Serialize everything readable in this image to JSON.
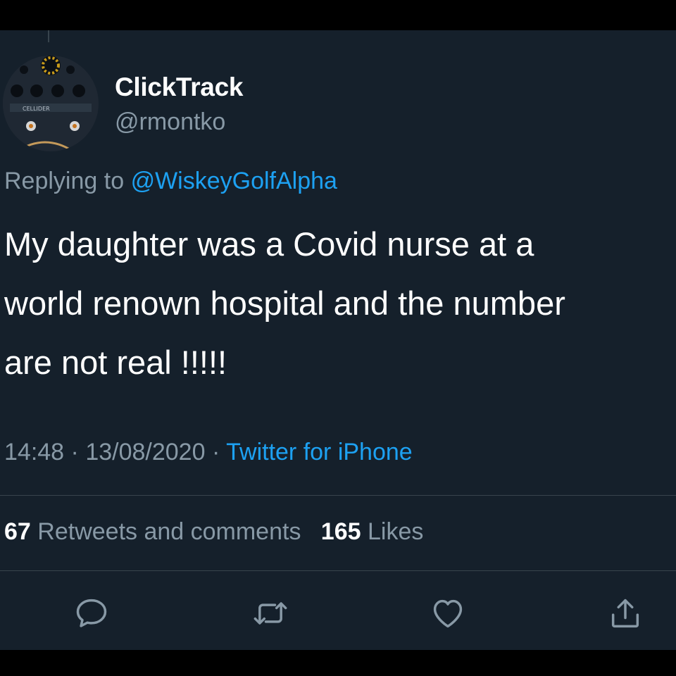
{
  "tweet": {
    "author_name": "ClickTrack",
    "author_handle": "@rmontko",
    "reply_prefix": "Replying to",
    "reply_to": "@WiskeyGolfAlpha",
    "text_lines": [
      "My daughter was a Covid nurse at a",
      "world renown hospital and the number",
      "are not real !!!!!"
    ],
    "time": "14:48",
    "date": "13/08/2020",
    "separator": "·",
    "source": "Twitter for iPhone",
    "retweets_count": "67",
    "retweets_label": "Retweets and comments",
    "likes_count": "165",
    "likes_label": "Likes"
  },
  "avatar_text": "CELLIDER",
  "actions": [
    {
      "name": "reply",
      "icon": "reply-icon"
    },
    {
      "name": "retweet",
      "icon": "retweet-icon"
    },
    {
      "name": "like",
      "icon": "heart-icon"
    },
    {
      "name": "share",
      "icon": "share-icon"
    }
  ],
  "colors": {
    "background": "#15202b",
    "text_primary": "#ffffff",
    "text_secondary": "#8899a6",
    "accent": "#1da1f2",
    "divider": "#38444d"
  }
}
